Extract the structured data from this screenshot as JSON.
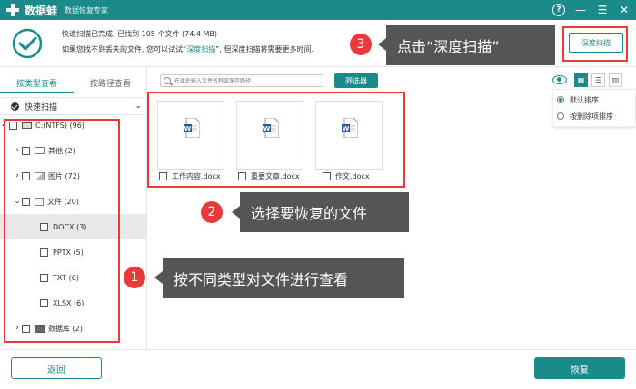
{
  "app": {
    "title": "数据蛙",
    "subtitle": "数据恢复专家",
    "help_label": "?",
    "minimize_label": "—",
    "menu_label": "☰",
    "close_label": "✕"
  },
  "status": {
    "line1": "快速扫描已完成, 已找到 105 个文件 (74.4 MB)",
    "line2_prefix": "如果您找不到丢失的文件, 您可以试试“",
    "line2_link": "深度扫描",
    "line2_suffix": "”, 但深度扫描将需要更多时间.",
    "deep_scan_label": "深度扫描"
  },
  "left": {
    "tabs": [
      {
        "label": "按类型查看",
        "active": true
      },
      {
        "label": "按路径查看",
        "active": false
      }
    ],
    "quick_scan_label": "快速扫描",
    "tree": [
      {
        "arrow": "✓",
        "label": "C:(NTFS) (96)",
        "icon": "drive-icon"
      },
      {
        "arrow": "›",
        "label": "其他 (2)",
        "icon": "folder-icon"
      },
      {
        "arrow": "›",
        "label": "图片 (72)",
        "icon": "image-icon"
      },
      {
        "arrow": "⌄",
        "label": "文件 (20)",
        "icon": "document-icon"
      },
      {
        "arrow": "",
        "label": "DOCX (3)",
        "icon": "",
        "selected": true
      },
      {
        "arrow": "",
        "label": "PPTX (5)",
        "icon": ""
      },
      {
        "arrow": "",
        "label": "TXT (6)",
        "icon": ""
      },
      {
        "arrow": "",
        "label": "XLSX (6)",
        "icon": ""
      },
      {
        "arrow": "›",
        "label": "数据库 (2)",
        "icon": "database-icon"
      }
    ]
  },
  "toolbar": {
    "search_placeholder": "在此处输入文件名称或保存路径",
    "filter_label": "筛选器",
    "view_grid": "▦",
    "view_list": "☰",
    "view_detail": "▥"
  },
  "sort": {
    "options": [
      {
        "label": "默认排序",
        "checked": true
      },
      {
        "label": "按删除项排序",
        "checked": false
      }
    ]
  },
  "files": [
    {
      "name": "工作内容.docx"
    },
    {
      "name": "重要文章.docx"
    },
    {
      "name": "作文.docx"
    }
  ],
  "callouts": [
    {
      "number": "3",
      "text": "点击“深度扫描”"
    },
    {
      "number": "2",
      "text": "选择要恢复的文件"
    },
    {
      "number": "1",
      "text": "按不同类型对文件进行查看"
    }
  ],
  "footer": {
    "back_label": "返回",
    "recover_label": "恢复"
  },
  "colors": {
    "accent": "#1a8a8a",
    "highlight": "#e83a3a",
    "callout_bg": "#555555",
    "word_blue": "#2b5797"
  }
}
